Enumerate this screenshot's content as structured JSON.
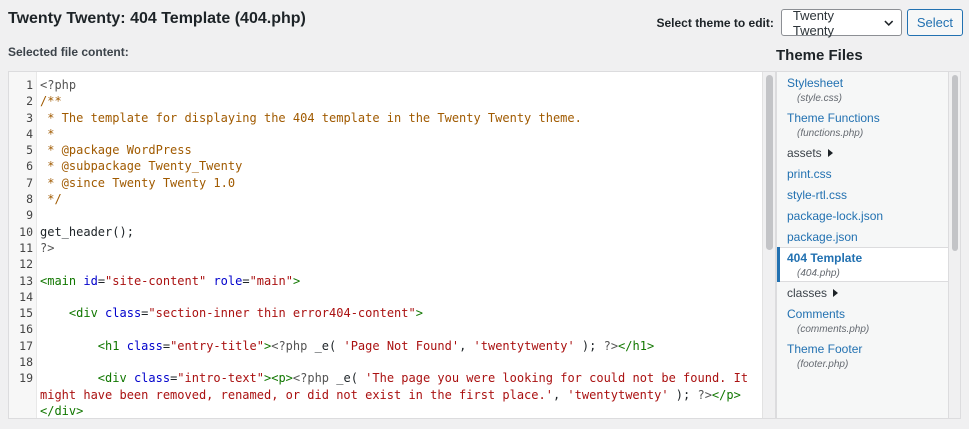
{
  "page": {
    "title": "Twenty Twenty: 404 Template (404.php)",
    "selected_label": "Selected file content:"
  },
  "theme_selector": {
    "label": "Select theme to edit:",
    "value": "Twenty Twenty",
    "button": "Select"
  },
  "code": [
    {
      "n": "1",
      "t": [
        [
          "meta",
          "<?php"
        ]
      ]
    },
    {
      "n": "2",
      "t": [
        [
          "comment",
          "/**"
        ]
      ]
    },
    {
      "n": "3",
      "t": [
        [
          "comment",
          " * The template for displaying the 404 template in the Twenty Twenty theme."
        ]
      ]
    },
    {
      "n": "4",
      "t": [
        [
          "comment",
          " *"
        ]
      ]
    },
    {
      "n": "5",
      "t": [
        [
          "comment",
          " * @package WordPress"
        ]
      ]
    },
    {
      "n": "6",
      "t": [
        [
          "comment",
          " * @subpackage Twenty_Twenty"
        ]
      ]
    },
    {
      "n": "7",
      "t": [
        [
          "comment",
          " * @since Twenty Twenty 1.0"
        ]
      ]
    },
    {
      "n": "8",
      "t": [
        [
          "comment",
          " */"
        ]
      ]
    },
    {
      "n": "9",
      "t": [
        [
          "plain",
          ""
        ]
      ]
    },
    {
      "n": "10",
      "t": [
        [
          "plain",
          "get_header();"
        ]
      ]
    },
    {
      "n": "11",
      "t": [
        [
          "meta",
          "?>"
        ]
      ]
    },
    {
      "n": "12",
      "t": [
        [
          "plain",
          ""
        ]
      ]
    },
    {
      "n": "13",
      "t": [
        [
          "tag",
          "<main"
        ],
        [
          "plain",
          " "
        ],
        [
          "attr",
          "id"
        ],
        [
          "plain",
          "="
        ],
        [
          "str",
          "\"site-content\""
        ],
        [
          "plain",
          " "
        ],
        [
          "attr",
          "role"
        ],
        [
          "plain",
          "="
        ],
        [
          "str",
          "\"main\""
        ],
        [
          "tag",
          ">"
        ]
      ]
    },
    {
      "n": "14",
      "t": [
        [
          "plain",
          ""
        ]
      ]
    },
    {
      "n": "15",
      "t": [
        [
          "plain",
          "    "
        ],
        [
          "tag",
          "<div"
        ],
        [
          "plain",
          " "
        ],
        [
          "attr",
          "class"
        ],
        [
          "plain",
          "="
        ],
        [
          "str",
          "\"section-inner thin error404-content\""
        ],
        [
          "tag",
          ">"
        ]
      ]
    },
    {
      "n": "16",
      "t": [
        [
          "plain",
          ""
        ]
      ]
    },
    {
      "n": "17",
      "t": [
        [
          "plain",
          "        "
        ],
        [
          "tag",
          "<h1"
        ],
        [
          "plain",
          " "
        ],
        [
          "attr",
          "class"
        ],
        [
          "plain",
          "="
        ],
        [
          "str",
          "\"entry-title\""
        ],
        [
          "tag",
          ">"
        ],
        [
          "meta",
          "<?php"
        ],
        [
          "plain",
          " _e( "
        ],
        [
          "str",
          "'Page Not Found'"
        ],
        [
          "plain",
          ", "
        ],
        [
          "str",
          "'twentytwenty'"
        ],
        [
          "plain",
          " ); "
        ],
        [
          "meta",
          "?>"
        ],
        [
          "tag",
          "</h1>"
        ]
      ]
    },
    {
      "n": "18",
      "t": [
        [
          "plain",
          ""
        ]
      ]
    },
    {
      "n": "19",
      "t": [
        [
          "plain",
          "        "
        ],
        [
          "tag",
          "<div"
        ],
        [
          "plain",
          " "
        ],
        [
          "attr",
          "class"
        ],
        [
          "plain",
          "="
        ],
        [
          "str",
          "\"intro-text\""
        ],
        [
          "tag",
          "><p>"
        ],
        [
          "meta",
          "<?php"
        ],
        [
          "plain",
          " _e( "
        ],
        [
          "str",
          "'The page you were looking for could not be found. It might have been removed, renamed, or did not exist in the first place.'"
        ],
        [
          "plain",
          ", "
        ],
        [
          "str",
          "'twentytwenty'"
        ],
        [
          "plain",
          " ); "
        ],
        [
          "meta",
          "?>"
        ],
        [
          "tag",
          "</p>"
        ],
        [
          "plain",
          "\n"
        ],
        [
          "tag",
          "</div>"
        ]
      ]
    }
  ],
  "theme_files": {
    "title": "Theme Files",
    "items": [
      {
        "name": "Stylesheet",
        "path": "(style.css)",
        "type": "file"
      },
      {
        "name": "Theme Functions",
        "path": "(functions.php)",
        "type": "file"
      },
      {
        "name": "assets",
        "path": "",
        "type": "dir"
      },
      {
        "name": "print.css",
        "path": "",
        "type": "file"
      },
      {
        "name": "style-rtl.css",
        "path": "",
        "type": "file"
      },
      {
        "name": "package-lock.json",
        "path": "",
        "type": "file"
      },
      {
        "name": "package.json",
        "path": "",
        "type": "file"
      },
      {
        "name": "404 Template",
        "path": "(404.php)",
        "type": "active"
      },
      {
        "name": "classes",
        "path": "",
        "type": "dir"
      },
      {
        "name": "Comments",
        "path": "(comments.php)",
        "type": "file"
      },
      {
        "name": "Theme Footer",
        "path": "(footer.php)",
        "type": "file"
      }
    ]
  },
  "colors": {
    "accent": "#2271b1",
    "comment": "#a05a00",
    "tag": "#117700",
    "attr": "#0000cc",
    "string": "#aa1111"
  }
}
